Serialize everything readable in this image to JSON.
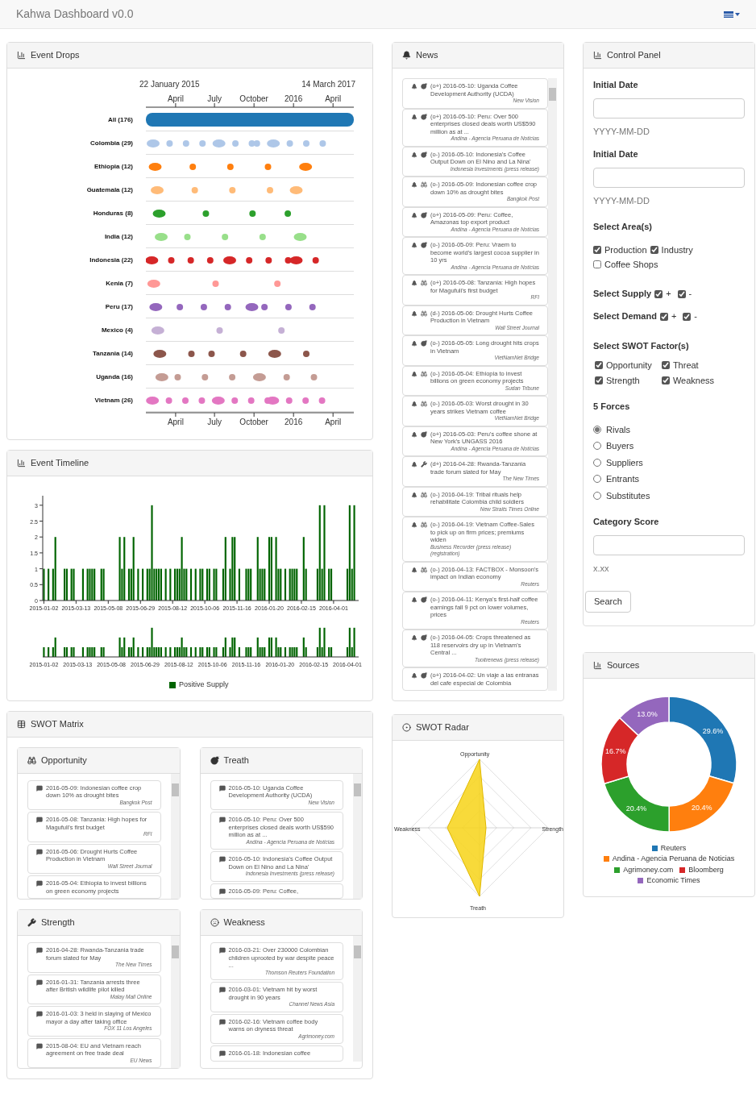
{
  "header": {
    "title": "Kahwa Dashboard v0.0"
  },
  "event_drops": {
    "title": "Event Drops",
    "start_date": "22 January 2015",
    "end_date": "14 March 2017",
    "top_ticks": [
      "April",
      "July",
      "October",
      "2016",
      "April"
    ],
    "bottom_ticks": [
      "April",
      "July",
      "October",
      "2016",
      "April"
    ],
    "rows": [
      {
        "label": "All (176)",
        "kind": "all",
        "color": "#1f77b4"
      },
      {
        "label": "Colombia (29)",
        "kind": "events",
        "color": "#aec7e8"
      },
      {
        "label": "Ethiopia (12)",
        "kind": "events",
        "color": "#ff7f0e"
      },
      {
        "label": "Guatemala (12)",
        "kind": "events",
        "color": "#ffbb78"
      },
      {
        "label": "Honduras (8)",
        "kind": "events",
        "color": "#2ca02c"
      },
      {
        "label": "India (12)",
        "kind": "events",
        "color": "#98df8a"
      },
      {
        "label": "Indonesia (22)",
        "kind": "events",
        "color": "#d62728"
      },
      {
        "label": "Kenia (7)",
        "kind": "events",
        "color": "#ff9896"
      },
      {
        "label": "Peru (17)",
        "kind": "events",
        "color": "#9467bd"
      },
      {
        "label": "Mexico (4)",
        "kind": "events",
        "color": "#c5b0d5"
      },
      {
        "label": "Tanzania (14)",
        "kind": "events",
        "color": "#8c564b"
      },
      {
        "label": "Uganda (16)",
        "kind": "events",
        "color": "#c49c94"
      },
      {
        "label": "Vietnam (26)",
        "kind": "events",
        "color": "#e377c2"
      }
    ]
  },
  "event_timeline": {
    "title": "Event Timeline",
    "chart_data": {
      "type": "bar",
      "ylim": [
        0,
        3.3
      ],
      "yticks": [
        0,
        0.5,
        1,
        1.5,
        2,
        2.5,
        3
      ],
      "categories": [
        "2015-01-02",
        null,
        null,
        null,
        null,
        null,
        null,
        null,
        null,
        null,
        null,
        null,
        null,
        null,
        "2015-03-13",
        null,
        null,
        null,
        null,
        null,
        null,
        null,
        null,
        null,
        null,
        null,
        null,
        null,
        "2015-05-08",
        null,
        null,
        null,
        null,
        null,
        null,
        null,
        null,
        null,
        null,
        null,
        null,
        null,
        "2015-06-29",
        null,
        null,
        null,
        null,
        null,
        null,
        null,
        null,
        null,
        null,
        null,
        null,
        null,
        "2015-08-12",
        null,
        null,
        null,
        null,
        null,
        null,
        null,
        null,
        null,
        null,
        null,
        null,
        null,
        "2015-10-06",
        null,
        null,
        null,
        null,
        null,
        null,
        null,
        null,
        null,
        null,
        null,
        null,
        null,
        "2015-11-16",
        null,
        null,
        null,
        null,
        null,
        null,
        null,
        null,
        null,
        null,
        null,
        null,
        null,
        "2016-01-20",
        null,
        null,
        null,
        null,
        null,
        null,
        null,
        null,
        null,
        null,
        null,
        null,
        null,
        "2016-02-15",
        null,
        null,
        null,
        null,
        null,
        null,
        null,
        null,
        null,
        null,
        null,
        null,
        null,
        "2016-04-01",
        null,
        null,
        null,
        null,
        null,
        null,
        null,
        null,
        null
      ],
      "series": [
        {
          "name": "Positive Supply",
          "color": "#006400",
          "values": [
            1,
            0,
            1,
            0,
            1,
            2,
            0,
            0,
            0,
            1,
            1,
            0,
            1,
            1,
            0,
            0,
            0,
            1,
            0,
            1,
            1,
            1,
            1,
            0,
            0,
            1,
            1,
            0,
            0,
            0,
            0,
            0,
            0,
            2,
            1,
            2,
            0,
            1,
            1,
            2,
            0,
            1,
            0,
            1,
            0,
            1,
            1,
            3,
            1,
            1,
            1,
            1,
            0,
            1,
            0,
            1,
            0,
            1,
            1,
            1,
            2,
            1,
            1,
            0,
            1,
            0,
            1,
            0,
            1,
            1,
            0,
            1,
            1,
            0,
            1,
            1,
            0,
            0,
            1,
            2,
            0,
            1,
            2,
            2,
            0,
            1,
            0,
            0,
            1,
            1,
            1,
            0,
            0,
            2,
            1,
            1,
            1,
            0,
            2,
            2,
            0,
            2,
            1,
            1,
            0,
            1,
            0,
            1,
            1,
            1,
            1,
            0,
            0,
            2,
            1,
            0,
            0,
            0,
            0,
            1,
            3,
            1,
            3,
            0,
            1,
            1,
            0,
            0,
            0,
            0,
            0,
            0,
            1,
            3,
            1,
            3
          ]
        }
      ]
    },
    "brush": {
      "axis_labels": [
        "2015-01-02",
        "2015-03-13",
        "2015-05-08",
        "2015-06-29",
        "2015-08-12",
        "2015-10-06",
        "2015-11-16",
        "2016-01-20",
        "2016-02-15",
        "2016-04-01"
      ]
    }
  },
  "swot_matrix": {
    "title": "SWOT Matrix",
    "quadrants": [
      {
        "kind": "opportunity",
        "title": "Opportunity",
        "items": [
          {
            "text": "2016-05-09: Indonesian coffee crop down 10% as drought bites",
            "source": "Bangkok Post"
          },
          {
            "text": "2016-05-08: Tanzania: High hopes for Magufuli's first budget",
            "source": "RFI"
          },
          {
            "text": "2016-05-06: Drought Hurts Coffee Production in Vietnam",
            "source": "Wall Street Journal"
          },
          {
            "text": "2016-05-04: Ethiopia to invest billions on green economy projects"
          }
        ]
      },
      {
        "kind": "threat",
        "title": "Treath",
        "items": [
          {
            "text": "2016-05-10: Uganda Coffee Development Authority (UCDA)",
            "source": "New Vision"
          },
          {
            "text": "2016-05-10: Peru: Over 500 enterprises closed deals worth US$590 million as at ...",
            "source": "Andina - Agencia Peruana de Noticias"
          },
          {
            "text": "2016-05-10: Indonesia's Coffee Output Down on El Nino and La Nina'",
            "source": "Indonesia Investments (press release)"
          },
          {
            "text": "2016-05-09: Peru: Coffee,"
          }
        ]
      },
      {
        "kind": "strength",
        "title": "Strength",
        "items": [
          {
            "text": "2016-04-28: Rwanda-Tanzania trade forum slated for May",
            "source": "The New Times"
          },
          {
            "text": "2016-01-31: Tanzania arrests three after British wildlife pilot killed",
            "source": "Malay Mail Online"
          },
          {
            "text": "2016-01-03: 3 held in slaying of Mexico mayor a day after taking office",
            "source": "FOX 11 Los Angeles"
          },
          {
            "text": "2015-08-04: EU and Vietnam reach agreement on free trade deal",
            "source": "EU News"
          }
        ]
      },
      {
        "kind": "weakness",
        "title": "Weakness",
        "items": [
          {
            "text": "2016-03-21: Over 230000 Colombian children uprooted by war despite peace ...",
            "source": "Thomson Reuters Foundation"
          },
          {
            "text": "2016-03-01: Vietnam hit by worst drought in 90 years",
            "source": "Channel News Asia"
          },
          {
            "text": "2016-02-16: Vietnam coffee body warns on dryness threat",
            "source": "Agrimoney.com"
          },
          {
            "text": "2016-01-18: Indonesian coffee"
          }
        ]
      }
    ]
  },
  "news": {
    "title": "News",
    "items": [
      {
        "kind": "threat",
        "text": "(o+) 2016-05-10: Uganda Coffee Development Authority (UCDA)",
        "source": "New Vision"
      },
      {
        "kind": "threat",
        "text": "(o+) 2016-05-10: Peru: Over 500 enterprises closed deals worth US$590 million as at ...",
        "source": "Andina - Agencia Peruana de Noticias"
      },
      {
        "kind": "threat",
        "text": "(o-) 2016-05-10: Indonesia's Coffee Output Down on El Nino and La Nina'",
        "source": "Indonesia Investments (press release)"
      },
      {
        "kind": "opportunity",
        "text": "(o-) 2016-05-09: Indonesian coffee crop down 10% as drought bites",
        "source": "Bangkok Post"
      },
      {
        "kind": "threat",
        "text": "(o+) 2016-05-09: Peru: Coffee, Amazonas top export product",
        "source": "Andina - Agencia Peruana de Noticias"
      },
      {
        "kind": "threat",
        "text": "(o-) 2016-05-09: Peru: Vraem to become world's largest cocoa supplier in 10 yrs",
        "source": "Andina - Agencia Peruana de Noticias"
      },
      {
        "kind": "opportunity",
        "text": "(o+) 2016-05-08: Tanzania: High hopes for Magufuli's first budget",
        "source": "RFI"
      },
      {
        "kind": "opportunity",
        "text": "(d-) 2016-05-06: Drought Hurts Coffee Production in Vietnam",
        "source": "Wall Street Journal"
      },
      {
        "kind": "threat",
        "text": "(o-) 2016-05-05: Long drought hits crops in Vietnam",
        "source": "VietNamNet Bridge"
      },
      {
        "kind": "opportunity",
        "text": "(o-) 2016-05-04: Ethiopia to invest billions on green economy projects",
        "source": "Sudan Tribune"
      },
      {
        "kind": "opportunity",
        "text": "(o-) 2016-05-03: Worst drought in 30 years strikes Vietnam coffee",
        "source": "VietNamNet Bridge"
      },
      {
        "kind": "threat",
        "text": "(o+) 2016-05-03: Peru's coffee shone at New York's UNGASS 2016",
        "source": "Andina - Agencia Peruana de Noticias"
      },
      {
        "kind": "strength",
        "text": "(d+) 2016-04-28: Rwanda-Tanzania trade forum slated for May",
        "source": "The New Times"
      },
      {
        "kind": "opportunity",
        "text": "(o-) 2016-04-19: Tribal rituals help rehabilitate Colombia child soldiers",
        "source": "New Straits Times Online"
      },
      {
        "kind": "opportunity",
        "text": "(o-) 2016-04-19: Vietnam Coffee-Sales to pick up on firm prices; premiums widen",
        "source": "Business Recorder (press release) (registration)"
      },
      {
        "kind": "opportunity",
        "text": "(o-) 2016-04-13: FACTBOX - Monsoon's impact on Indian economy",
        "source": "Reuters"
      },
      {
        "kind": "threat",
        "text": "(o-) 2016-04-11: Kenya's first-half coffee earnings fall 9 pct on lower volumes, prices",
        "source": "Reuters"
      },
      {
        "kind": "threat",
        "text": "(o-) 2016-04-05: Crops threatened as 118 reservoirs dry up in Vietnam's Central ...",
        "source": "Tuoitrenews (press release)"
      },
      {
        "kind": "threat",
        "text": "(o+) 2016-04-02: Un viaje a las entranas del cafe especial de Colombia"
      }
    ]
  },
  "swot_radar": {
    "title": "SWOT Radar",
    "axes": [
      "Opportunity",
      "Strength",
      "Treath",
      "Weakness"
    ]
  },
  "control_panel": {
    "title": "Control Panel",
    "date_fields": [
      {
        "label": "Initial Date",
        "help": "YYYY-MM-DD"
      },
      {
        "label": "Initial Date",
        "help": "YYYY-MM-DD"
      }
    ],
    "areas": {
      "label": "Select Area(s)",
      "options": [
        {
          "label": "Production",
          "checked": true
        },
        {
          "label": "Industry",
          "checked": true
        },
        {
          "label": "Coffee Shops",
          "checked": false
        }
      ]
    },
    "supply": {
      "label": "Select Supply",
      "options": [
        {
          "label": "+",
          "checked": true
        },
        {
          "label": "-",
          "checked": true
        }
      ]
    },
    "demand": {
      "label": "Select Demand",
      "options": [
        {
          "label": "+",
          "checked": true
        },
        {
          "label": "-",
          "checked": true
        }
      ]
    },
    "swot_factors": {
      "label": "Select SWOT Factor(s)",
      "options": [
        {
          "label": "Opportunity",
          "checked": true
        },
        {
          "label": "Threat",
          "checked": true
        },
        {
          "label": "Strength",
          "checked": true
        },
        {
          "label": "Weakness",
          "checked": true
        }
      ]
    },
    "forces": {
      "label": "5 Forces",
      "options": [
        {
          "label": "Rivals",
          "selected": true
        },
        {
          "label": "Buyers",
          "selected": false
        },
        {
          "label": "Suppliers",
          "selected": false
        },
        {
          "label": "Entrants",
          "selected": false
        },
        {
          "label": "Substitutes",
          "selected": false
        }
      ]
    },
    "score": {
      "label": "Category Score",
      "help": "x.xx"
    },
    "search_button": "Search"
  },
  "sources": {
    "title": "Sources",
    "chart_data": {
      "type": "donut",
      "categories": [
        "Reuters",
        "Andina - Agencia Peruana de Noticias",
        "Agrimoney.com",
        "Bloomberg",
        "Economic Times"
      ],
      "series": [
        {
          "values": [
            29.6,
            20.4,
            20.4,
            16.7,
            13.0
          ]
        }
      ],
      "legend": "bottom",
      "colors": [
        "#1f77b4",
        "#ff7f0e",
        "#2ca02c",
        "#d62728",
        "#9467bd"
      ],
      "value_labels": [
        "29.6%",
        "20.4%",
        "20.4%",
        "16.7%",
        "13.0%"
      ]
    }
  }
}
